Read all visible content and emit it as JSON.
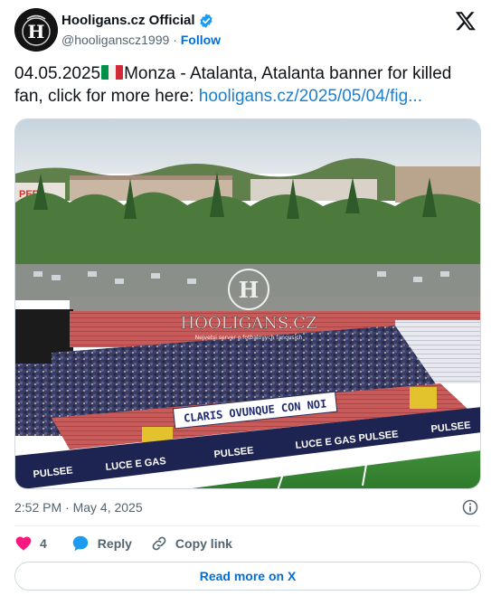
{
  "account": {
    "display_name": "Hooligans.cz Official",
    "handle": "@hooliganscz1999",
    "separator": "·",
    "follow_label": "Follow",
    "avatar_monogram": "H",
    "verified": true
  },
  "tweet": {
    "date_prefix": "04.05.2025",
    "flag": "Italy",
    "text": "Monza - Atalanta, Atalanta banner for killed fan, click for more here: ",
    "link": "hooligans.cz/2025/05/04/fig...",
    "timestamp": "2:52 PM · May 4, 2025"
  },
  "media": {
    "watermark": "HOOLIGANS.CZ",
    "watermark_sub": "Nejvetsi server o fotbalovych fanousich",
    "banner_text": "CLARIS OVUNQUE CON NOI",
    "ad_boards": [
      "PULSEE",
      "LUCE E GAS",
      "PULSEE",
      "LUCE E GAS",
      "PULSEE",
      "PULSEE"
    ],
    "sign_partial": "PER"
  },
  "actions": {
    "like_count": "4",
    "reply_label": "Reply",
    "copy_link_label": "Copy link"
  },
  "read_more_label": "Read more on X",
  "colors": {
    "like": "#f91880",
    "reply": "#1d9bf0",
    "link": "#1d7fce",
    "verified": "#1d9bf0"
  }
}
